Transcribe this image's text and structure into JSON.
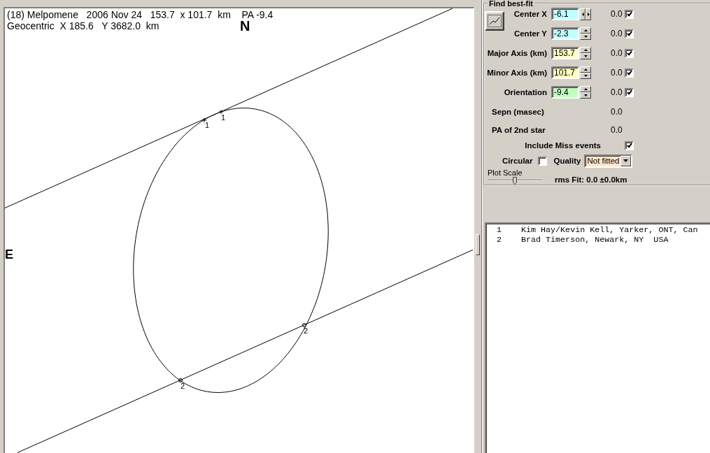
{
  "plot": {
    "header_lines": [
      "(18) Melpomene   2006 Nov 24   153.7  x 101.7  km    PA -9.4",
      "Geocentric  X 185.6   Y 3682.0  km"
    ],
    "north_label": "N",
    "east_label": "E",
    "chords": [
      {
        "kind": "cross",
        "events": [
          "1",
          "1"
        ]
      },
      {
        "kind": "circle",
        "events": [
          "2",
          "2"
        ]
      }
    ]
  },
  "fit_panel": {
    "title": "Find best-fit",
    "parameters": [
      {
        "kind": "horizontal",
        "label": "Center X",
        "value": "-6.1",
        "color": "#c0ffff",
        "result": "0.0",
        "checked": true
      },
      {
        "kind": "vertical",
        "label": "Center Y",
        "value": "-2.3",
        "color": "#c0ffff",
        "result": "0.0",
        "checked": true
      },
      {
        "kind": "vertical",
        "label": "Major Axis (km)",
        "value": "153.7",
        "color": "#ffffc0",
        "result": "0.0",
        "checked": true
      },
      {
        "kind": "vertical",
        "label": "Minor Axis (km)",
        "value": "101.7",
        "color": "#ffffc0",
        "result": "0.0",
        "checked": true
      },
      {
        "kind": "vertical",
        "label": "Orientation",
        "value": "-9.4",
        "color": "#c0ffc0",
        "result": "0.0",
        "checked": true
      }
    ],
    "readouts": [
      {
        "label": "Sepn (masec)",
        "value": "0.0"
      },
      {
        "label": "PA of 2nd star",
        "value": "0.0"
      }
    ],
    "include_miss_events": {
      "label": "Include Miss events",
      "checked": true
    },
    "circular": {
      "label": "Circular",
      "checked": false
    },
    "quality": {
      "label": "Quality",
      "value": "Not fitted"
    },
    "plot_scale": {
      "label": "Plot Scale",
      "level": 0.5
    },
    "rms_fit": "rms Fit: 0.0 ±0.0km"
  },
  "observers": [
    {
      "number": "1",
      "name": "Kim Hay/Kevin Kell, Yarker, ONT, Can"
    },
    {
      "number": "2",
      "name": "Brad Timerson, Newark, NY  USA"
    }
  ]
}
